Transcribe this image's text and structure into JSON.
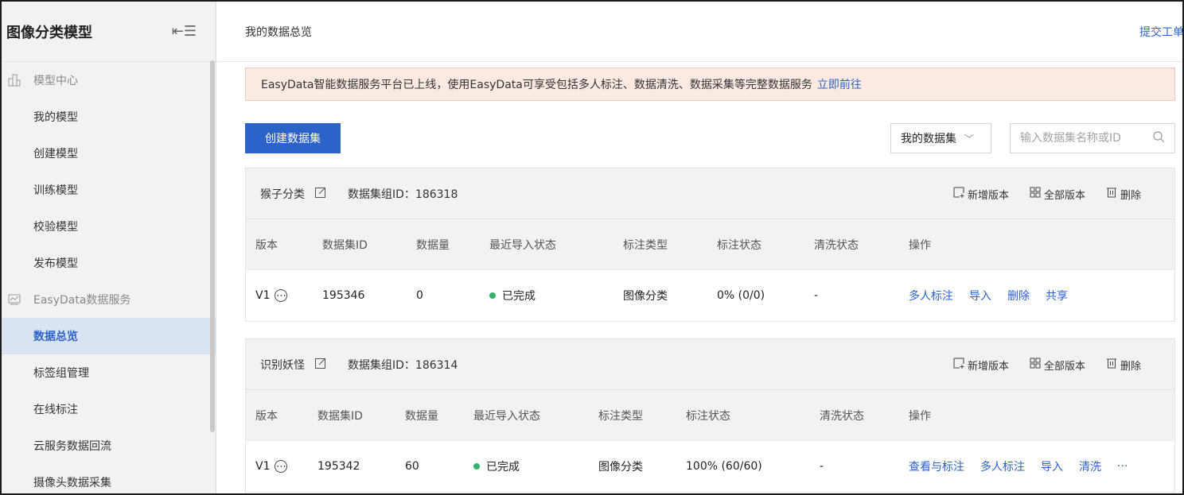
{
  "sidebar": {
    "title": "图像分类模型",
    "groups": [
      {
        "label": "模型中心",
        "icon": "model-icon",
        "items": [
          "我的模型",
          "创建模型",
          "训练模型",
          "校验模型",
          "发布模型"
        ]
      },
      {
        "label": "EasyData数据服务",
        "icon": "chart-icon",
        "items": [
          "数据总览",
          "标签组管理",
          "在线标注",
          "云服务数据回流",
          "摄像头数据采集"
        ]
      }
    ],
    "active": "数据总览"
  },
  "header": {
    "breadcrumb": "我的数据总览",
    "ticket_link": "提交工单"
  },
  "notice": {
    "text": "EasyData智能数据服务平台已上线，使用EasyData可享受包括多人标注、数据清洗、数据采集等完整数据服务",
    "link": "立即前往"
  },
  "toolbar": {
    "create_label": "创建数据集",
    "filter_selected": "我的数据集",
    "search_placeholder": "输入数据集名称或ID"
  },
  "card_actions": {
    "add_version": "新增版本",
    "all_versions": "全部版本",
    "delete": "删除"
  },
  "datasets": [
    {
      "name": "猴子分类",
      "group_id": "数据集组ID：186318",
      "columns": [
        "版本",
        "数据集ID",
        "数据量",
        "最近导入状态",
        "标注类型",
        "标注状态",
        "清洗状态",
        "操作"
      ],
      "row": {
        "version": "V1",
        "dataset_id": "195346",
        "count": "0",
        "import_status": "已完成",
        "label_type": "图像分类",
        "label_status": "0% (0/0)",
        "clean_status": "-",
        "actions": [
          "多人标注",
          "导入",
          "删除",
          "共享"
        ]
      }
    },
    {
      "name": "识别妖怪",
      "group_id": "数据集组ID：186314",
      "columns": [
        "版本",
        "数据集ID",
        "数据量",
        "最近导入状态",
        "标注类型",
        "标注状态",
        "清洗状态",
        "操作"
      ],
      "row": {
        "version": "V1",
        "dataset_id": "195342",
        "count": "60",
        "import_status": "已完成",
        "label_type": "图像分类",
        "label_status": "100% (60/60)",
        "clean_status": "-",
        "actions": [
          "查看与标注",
          "多人标注",
          "导入",
          "清洗",
          "···"
        ]
      }
    }
  ],
  "colors": {
    "accent": "#2d63c8",
    "success": "#36b36b",
    "notice_bg": "#fbe9e2"
  }
}
